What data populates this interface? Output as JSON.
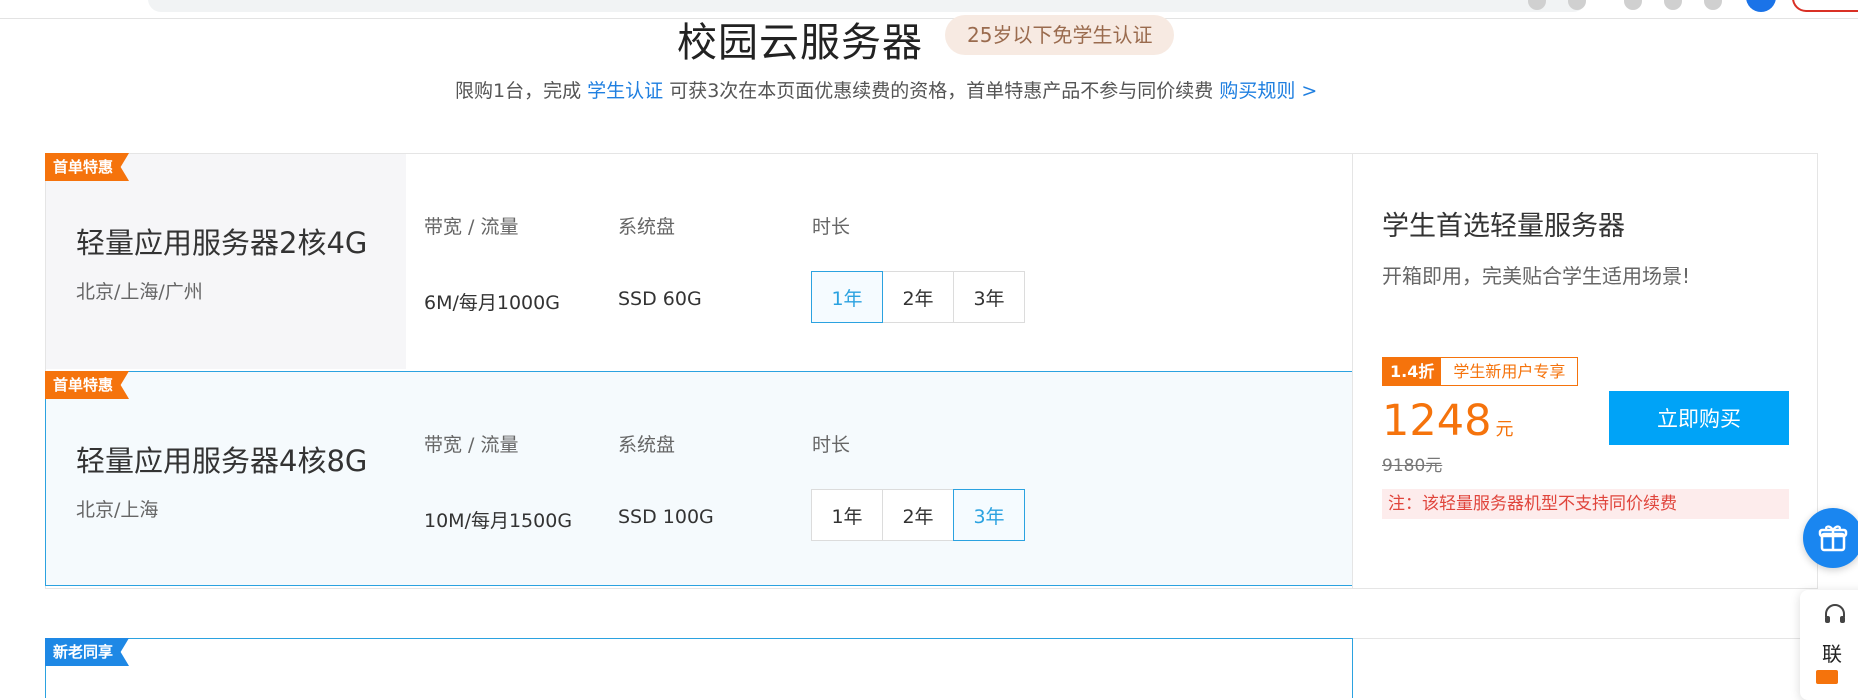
{
  "header": {
    "title": "校园云服务器",
    "badge": "25岁以下免学生认证",
    "subtitle_prefix": "限购1台，完成",
    "subtitle_link1": "学生认证",
    "subtitle_middle": "可获3次在本页面优惠续费的资格，首单特惠产品不参与同价续费",
    "subtitle_link2": "购买规则 >"
  },
  "column_headers": {
    "bandwidth": "带宽 / 流量",
    "disk": "系统盘",
    "duration": "时长"
  },
  "products": [
    {
      "ribbon": "首单特惠",
      "name": "轻量应用服务器2核4G",
      "region": "北京/上海/广州",
      "bandwidth": "6M/每月1000G",
      "disk": "SSD 60G",
      "durations": [
        "1年",
        "2年",
        "3年"
      ],
      "selected_duration": "1年"
    },
    {
      "ribbon": "首单特惠",
      "name": "轻量应用服务器4核8G",
      "region": "北京/上海",
      "bandwidth": "10M/每月1500G",
      "disk": "SSD 100G",
      "durations": [
        "1年",
        "2年",
        "3年"
      ],
      "selected_duration": "3年"
    }
  ],
  "next_section": {
    "ribbon": "新老同享"
  },
  "side_panel": {
    "title": "学生首选轻量服务器",
    "desc": "开箱即用，完美贴合学生适用场景!",
    "discount": "1.4折",
    "promo_tag": "学生新用户专享",
    "price": "1248",
    "price_unit": "元",
    "original_price": "9180元",
    "buy_label": "立即购买",
    "note": "注：该轻量服务器机型不支持同价续费"
  },
  "float_widget": {
    "contact_label": "联"
  },
  "colors": {
    "accent_blue": "#00a3f7",
    "link_blue": "#1f7fe0",
    "orange": "#f5730c",
    "selected_border": "#2ba2e0"
  }
}
